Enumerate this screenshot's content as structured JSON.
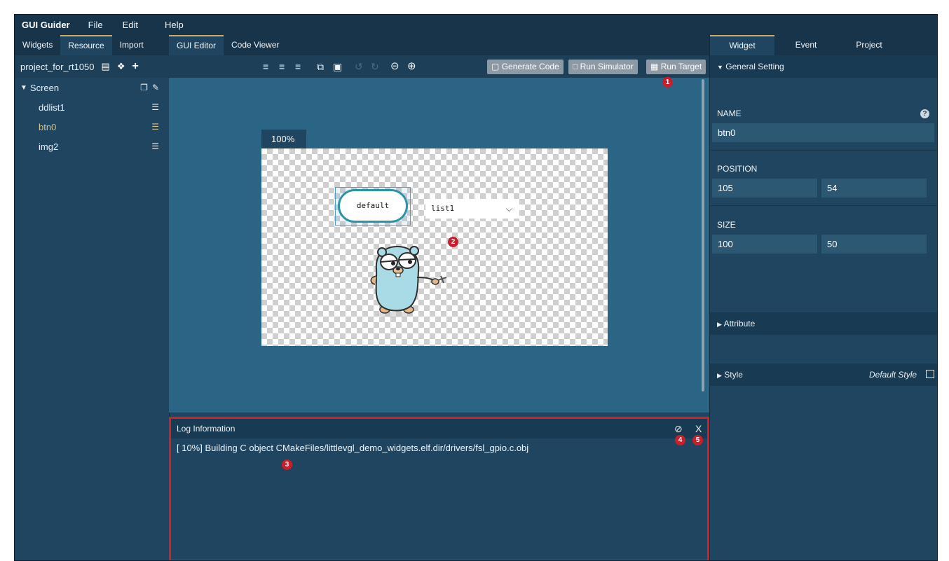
{
  "app": {
    "title": "GUI Guider"
  },
  "menu": [
    "File",
    "Edit",
    "Help"
  ],
  "left_tabs": [
    "Widgets",
    "Resource",
    "Import"
  ],
  "center_tabs": [
    "GUI Editor",
    "Code Viewer"
  ],
  "project": {
    "name": "project_for_rt1050"
  },
  "tree": {
    "root": "Screen",
    "children": [
      "ddlist1",
      "btn0",
      "img2"
    ],
    "selected": "btn0"
  },
  "toolbar": {
    "generate_code": "Generate Code",
    "run_simulator": "Run Simulator",
    "run_target": "Run Target"
  },
  "canvas": {
    "zoom": "100%",
    "button_text": "default",
    "dropdown_text": "list1"
  },
  "badges": [
    "1",
    "2",
    "3",
    "4",
    "5"
  ],
  "log": {
    "title": "Log Information",
    "line": "[ 10%] Building C object CMakeFiles/littlevgl_demo_widgets.elf.dir/drivers/fsl_gpio.c.obj"
  },
  "right": {
    "tabs": [
      "Widget",
      "Event",
      "Project"
    ],
    "general_setting": "General Setting",
    "name_label": "NAME",
    "name_value": "btn0",
    "position_label": "POSITION",
    "pos_x": "105",
    "pos_y": "54",
    "size_label": "SIZE",
    "width": "100",
    "height": "50",
    "attribute": "Attribute",
    "style": "Style",
    "default_style": "Default Style"
  },
  "colors": {
    "panel": "#1f4560",
    "canvas_bg": "#2a6585",
    "highlight": "#d0202a",
    "accent_tab": "#cba86c"
  }
}
